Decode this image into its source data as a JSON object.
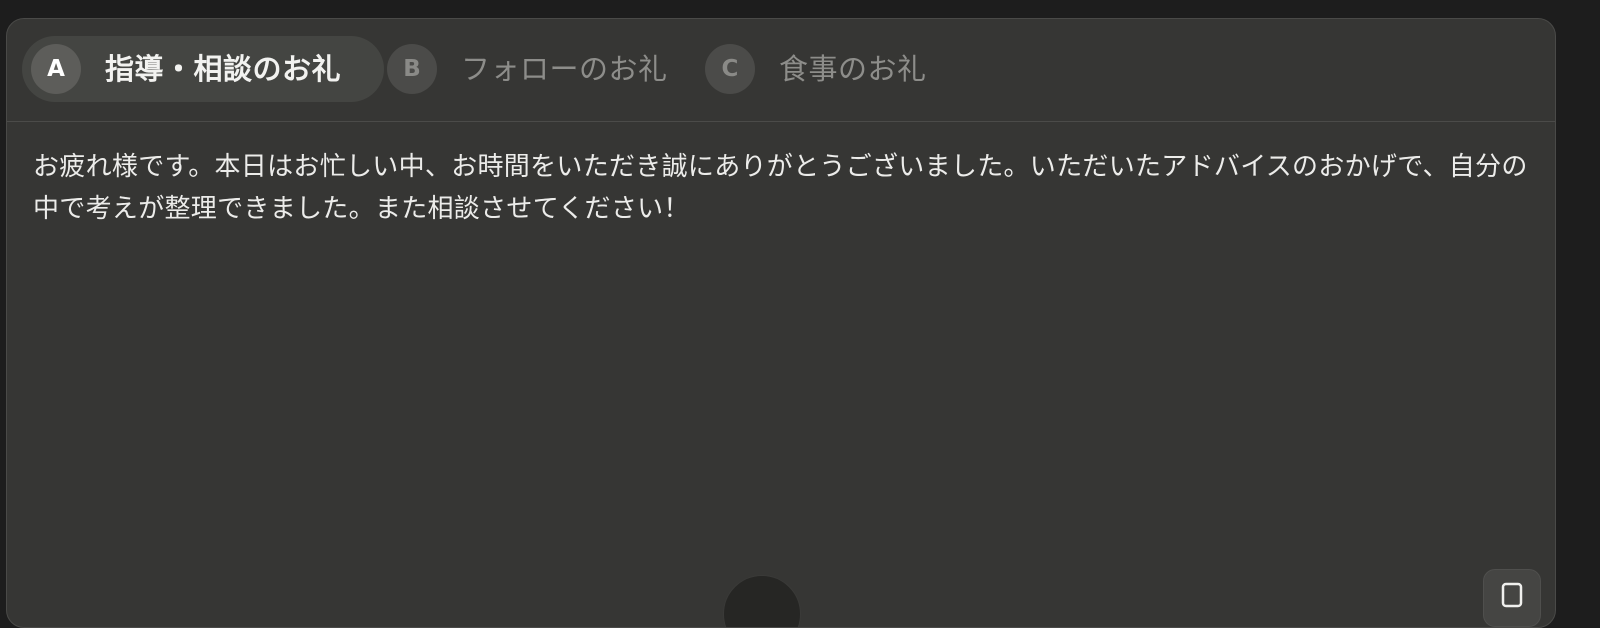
{
  "tabs": [
    {
      "letter": "A",
      "label": "指導・相談のお礼",
      "active": true
    },
    {
      "letter": "B",
      "label": "フォローのお礼",
      "active": false
    },
    {
      "letter": "C",
      "label": "食事のお礼",
      "active": false
    }
  ],
  "message": {
    "text": "お疲れ様です。本日はお忙しい中、お時間をいただき誠にありがとうございました。いただいたアドバイスのおかげで、自分の中で考えが整理できました。また相談させてください！"
  },
  "icons": {
    "copy": "copy-icon"
  },
  "colors": {
    "background": "#1d1d1d",
    "card": "#363634",
    "active_tab": "#444542",
    "text": "#ececea",
    "muted_text": "#8d8d8a"
  }
}
